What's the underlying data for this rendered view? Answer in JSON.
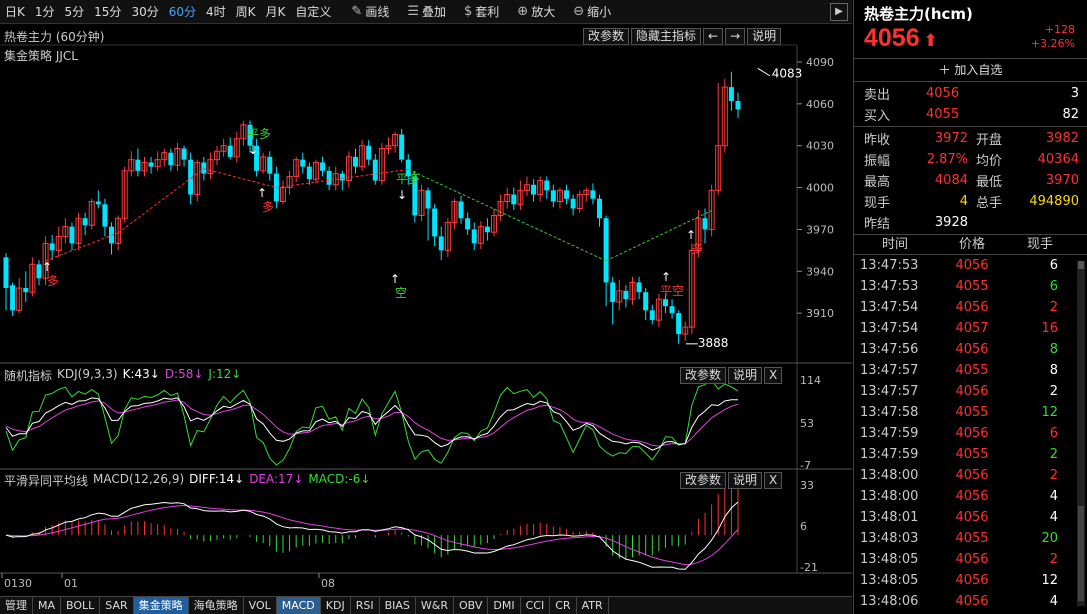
{
  "toolbar": {
    "timeframes": [
      "日K",
      "1分",
      "5分",
      "15分",
      "30分",
      "60分",
      "4时",
      "周K",
      "月K",
      "自定义"
    ],
    "active_timeframe": "60分",
    "tools": [
      {
        "icon": "pencil-icon",
        "glyph": "✎",
        "label": "画线"
      },
      {
        "icon": "layers-icon",
        "glyph": "☰",
        "label": "叠加"
      },
      {
        "icon": "moneybag-icon",
        "glyph": "$",
        "label": "套利"
      },
      {
        "icon": "zoom-in-icon",
        "glyph": "⊕",
        "label": "放大"
      },
      {
        "icon": "zoom-out-icon",
        "glyph": "⊖",
        "label": "缩小"
      }
    ],
    "nav_arrow": "▶"
  },
  "main_panel": {
    "title": "热卷主力 (60分钟)",
    "strategy": "集金策略 JJCL",
    "buttons": [
      "改参数",
      "隐藏主指标",
      "←",
      "→",
      "说明"
    ],
    "high_label": "4083",
    "low_label": "3888",
    "signals": [
      {
        "text": "平多",
        "color": "#33cc33",
        "x": 259,
        "y": 113
      },
      {
        "text": "多",
        "color": "#ff3030",
        "x": 268,
        "y": 186
      },
      {
        "text": "平多",
        "color": "#33cc33",
        "x": 408,
        "y": 158
      },
      {
        "text": "空",
        "color": "#33cc33",
        "x": 401,
        "y": 272
      },
      {
        "text": "多",
        "color": "#ff3030",
        "x": 53,
        "y": 260
      },
      {
        "text": "平空",
        "color": "#ff3030",
        "x": 672,
        "y": 270
      },
      {
        "text": "多",
        "color": "#ff3030",
        "x": 697,
        "y": 228
      }
    ]
  },
  "kdj_panel": {
    "name": "随机指标",
    "params": "KDJ(9,3,3)",
    "k": "K:43↓",
    "d": "D:58↓",
    "j": "J:12↓",
    "buttons": [
      "改参数",
      "说明",
      "X"
    ],
    "axis": [
      "114",
      "53",
      "-7"
    ]
  },
  "macd_panel": {
    "name": "平滑异同平均线",
    "params": "MACD(12,26,9)",
    "diff": "DIFF:14↓",
    "dea": "DEA:17↓",
    "macd": "MACD:-6↓",
    "buttons": [
      "改参数",
      "说明",
      "X"
    ],
    "axis": [
      "33",
      "6",
      "-21"
    ]
  },
  "price_axis": [
    "4090",
    "4060",
    "4030",
    "4000",
    "3970",
    "3940",
    "3910"
  ],
  "date_axis": [
    "0130",
    "01",
    "08"
  ],
  "bottom_tabs": [
    "管理",
    "MA",
    "BOLL",
    "SAR",
    "集金策略",
    "海龟策略",
    "VOL",
    "MACD",
    "KDJ",
    "RSI",
    "BIAS",
    "W&R",
    "OBV",
    "DMI",
    "CCI",
    "CR",
    "ATR"
  ],
  "bottom_tabs_active": "集金策略",
  "bottom_tabs_selected": "MACD",
  "quote": {
    "name": "热卷主力(hcm)",
    "price": "4056",
    "arrow": "⬆",
    "change": "+128",
    "change_pct": "+3.26%",
    "add_watch": "加入自选",
    "sell_label": "卖出",
    "sell_price": "4056",
    "sell_vol": "3",
    "buy_label": "买入",
    "buy_price": "4055",
    "buy_vol": "82",
    "stats": [
      {
        "l1": "昨收",
        "v1": "3972",
        "c1": "#ff3030",
        "l2": "开盘",
        "v2": "3982",
        "c2": "#ff3030"
      },
      {
        "l1": "振幅",
        "v1": "2.87%",
        "c1": "#ff3030",
        "l2": "均价",
        "v2": "40364",
        "c2": "#ff3030"
      },
      {
        "l1": "最高",
        "v1": "4084",
        "c1": "#ff3030",
        "l2": "最低",
        "v2": "3970",
        "c2": "#ff3030"
      },
      {
        "l1": "现手",
        "v1": "4",
        "c1": "#ffd700",
        "l2": "总手",
        "v2": "494890",
        "c2": "#ffd700"
      },
      {
        "l1": "昨结",
        "v1": "3928",
        "c1": "#ffffff",
        "l2": "",
        "v2": "",
        "c2": "#ffffff"
      }
    ],
    "tick_headers": [
      "时间",
      "价格",
      "现手"
    ],
    "ticks": [
      [
        "13:47:53",
        "4056",
        "6",
        "#ffffff"
      ],
      [
        "13:47:53",
        "4055",
        "6",
        "#33dd33"
      ],
      [
        "13:47:54",
        "4056",
        "2",
        "#ff3030"
      ],
      [
        "13:47:54",
        "4057",
        "16",
        "#ff3030"
      ],
      [
        "13:47:56",
        "4056",
        "8",
        "#33dd33"
      ],
      [
        "13:47:57",
        "4055",
        "8",
        "#ffffff"
      ],
      [
        "13:47:57",
        "4056",
        "2",
        "#ffffff"
      ],
      [
        "13:47:58",
        "4055",
        "12",
        "#33dd33"
      ],
      [
        "13:47:59",
        "4056",
        "6",
        "#ff3030"
      ],
      [
        "13:47:59",
        "4055",
        "2",
        "#33dd33"
      ],
      [
        "13:48:00",
        "4056",
        "2",
        "#ff3030"
      ],
      [
        "13:48:00",
        "4056",
        "4",
        "#ffffff"
      ],
      [
        "13:48:01",
        "4056",
        "4",
        "#ffffff"
      ],
      [
        "13:48:03",
        "4055",
        "20",
        "#33dd33"
      ],
      [
        "13:48:05",
        "4056",
        "2",
        "#ff3030"
      ],
      [
        "13:48:05",
        "4056",
        "12",
        "#ffffff"
      ],
      [
        "13:48:06",
        "4056",
        "4",
        "#ffffff"
      ]
    ]
  },
  "chart_data": {
    "type": "candlestick",
    "y_range": [
      3880,
      4095
    ],
    "candles": [
      [
        3950,
        3928,
        3953,
        3912
      ],
      [
        3930,
        3912,
        3932,
        3908
      ],
      [
        3912,
        3928,
        3935,
        3910
      ],
      [
        3928,
        3925,
        3940,
        3918
      ],
      [
        3925,
        3945,
        3950,
        3922
      ],
      [
        3945,
        3935,
        3948,
        3930
      ],
      [
        3935,
        3960,
        3965,
        3930
      ],
      [
        3960,
        3955,
        3966,
        3948
      ],
      [
        3955,
        3965,
        3972,
        3950
      ],
      [
        3965,
        3972,
        3978,
        3960
      ],
      [
        3972,
        3960,
        3975,
        3955
      ],
      [
        3960,
        3978,
        3982,
        3955
      ],
      [
        3978,
        3973,
        3982,
        3966
      ],
      [
        3973,
        3990,
        3992,
        3970
      ],
      [
        3990,
        3988,
        3998,
        3985
      ],
      [
        3988,
        3972,
        3992,
        3965
      ],
      [
        3972,
        3960,
        3975,
        3952
      ],
      [
        3960,
        3978,
        3980,
        3955
      ],
      [
        3978,
        4012,
        4015,
        3975
      ],
      [
        4012,
        4020,
        4026,
        4008
      ],
      [
        4020,
        4012,
        4028,
        4008
      ],
      [
        4012,
        4018,
        4022,
        4008
      ],
      [
        4018,
        4015,
        4022,
        4010
      ],
      [
        4015,
        4020,
        4026,
        4012
      ],
      [
        4020,
        4025,
        4028,
        4015
      ],
      [
        4025,
        4016,
        4028,
        4012
      ],
      [
        4016,
        4028,
        4032,
        4012
      ],
      [
        4028,
        4020,
        4030,
        4015
      ],
      [
        4020,
        3995,
        4025,
        3988
      ],
      [
        3995,
        4018,
        4020,
        3990
      ],
      [
        4018,
        4010,
        4022,
        4005
      ],
      [
        4010,
        4020,
        4025,
        4006
      ],
      [
        4020,
        4026,
        4030,
        4016
      ],
      [
        4026,
        4030,
        4035,
        4022
      ],
      [
        4030,
        4022,
        4036,
        4020
      ],
      [
        4022,
        4035,
        4040,
        4018
      ],
      [
        4035,
        4045,
        4048,
        4030
      ],
      [
        4045,
        4030,
        4048,
        4025
      ],
      [
        4030,
        4012,
        4035,
        4008
      ],
      [
        4012,
        4022,
        4025,
        4010
      ],
      [
        4022,
        4010,
        4026,
        4005
      ],
      [
        4010,
        3990,
        4015,
        3985
      ],
      [
        3990,
        4000,
        4005,
        3988
      ],
      [
        4000,
        4008,
        4012,
        3995
      ],
      [
        4008,
        4020,
        4022,
        4004
      ],
      [
        4020,
        4015,
        4025,
        4010
      ],
      [
        4015,
        4006,
        4018,
        4002
      ],
      [
        4006,
        4018,
        4020,
        4003
      ],
      [
        4018,
        4012,
        4022,
        4008
      ],
      [
        4012,
        4002,
        4015,
        3998
      ],
      [
        4002,
        4010,
        4015,
        3998
      ],
      [
        4010,
        4005,
        4012,
        3998
      ],
      [
        4005,
        4022,
        4026,
        4000
      ],
      [
        4022,
        4015,
        4028,
        4010
      ],
      [
        4015,
        4030,
        4034,
        4012
      ],
      [
        4030,
        4020,
        4034,
        4016
      ],
      [
        4020,
        4005,
        4024,
        4002
      ],
      [
        4005,
        4028,
        4032,
        4002
      ],
      [
        4028,
        4030,
        4036,
        4024
      ],
      [
        4030,
        4038,
        4040,
        4025
      ],
      [
        4038,
        4020,
        4042,
        4018
      ],
      [
        4020,
        4008,
        4024,
        4002
      ],
      [
        4008,
        3980,
        4012,
        3975
      ],
      [
        3980,
        3998,
        4002,
        3976
      ],
      [
        3998,
        3985,
        4000,
        3962
      ],
      [
        3985,
        3965,
        3988,
        3958
      ],
      [
        3965,
        3955,
        3972,
        3948
      ],
      [
        3955,
        3975,
        3978,
        3950
      ],
      [
        3975,
        3990,
        3992,
        3970
      ],
      [
        3990,
        3978,
        3994,
        3974
      ],
      [
        3978,
        3970,
        3982,
        3966
      ],
      [
        3970,
        3960,
        3975,
        3955
      ],
      [
        3960,
        3972,
        3976,
        3956
      ],
      [
        3972,
        3968,
        3978,
        3962
      ],
      [
        3968,
        3980,
        3985,
        3965
      ],
      [
        3980,
        3990,
        3995,
        3976
      ],
      [
        3990,
        3995,
        4000,
        3985
      ],
      [
        3995,
        3988,
        4000,
        3984
      ],
      [
        3988,
        3998,
        4005,
        3984
      ],
      [
        3998,
        4002,
        4008,
        3994
      ],
      [
        4002,
        3995,
        4006,
        3990
      ],
      [
        3995,
        4005,
        4008,
        3990
      ],
      [
        4005,
        3998,
        4008,
        3992
      ],
      [
        3998,
        3990,
        4002,
        3986
      ],
      [
        3990,
        3998,
        4000,
        3985
      ],
      [
        3998,
        3992,
        4002,
        3988
      ],
      [
        3992,
        3985,
        3995,
        3980
      ],
      [
        3985,
        3995,
        3998,
        3982
      ],
      [
        3995,
        3998,
        4000,
        3990
      ],
      [
        3998,
        3992,
        4003,
        3988
      ],
      [
        3992,
        3978,
        3995,
        3972
      ],
      [
        3978,
        3932,
        3980,
        3915
      ],
      [
        3932,
        3918,
        3936,
        3902
      ],
      [
        3918,
        3926,
        3934,
        3912
      ],
      [
        3926,
        3920,
        3930,
        3914
      ],
      [
        3920,
        3932,
        3936,
        3916
      ],
      [
        3932,
        3925,
        3936,
        3920
      ],
      [
        3925,
        3912,
        3928,
        3905
      ],
      [
        3912,
        3905,
        3916,
        3902
      ],
      [
        3905,
        3920,
        3924,
        3900
      ],
      [
        3920,
        3915,
        3924,
        3910
      ],
      [
        3915,
        3910,
        3920,
        3906
      ],
      [
        3910,
        3895,
        3912,
        3888
      ],
      [
        3895,
        3900,
        3904,
        3890
      ],
      [
        3900,
        3955,
        3960,
        3895
      ],
      [
        3955,
        3978,
        3984,
        3950
      ],
      [
        3978,
        3970,
        3985,
        3960
      ],
      [
        3970,
        3998,
        4002,
        3965
      ],
      [
        3998,
        4030,
        4075,
        3995
      ],
      [
        4030,
        4072,
        4078,
        4025
      ],
      [
        4072,
        4062,
        4083,
        4055
      ],
      [
        4062,
        4056,
        4068,
        4050
      ]
    ]
  }
}
